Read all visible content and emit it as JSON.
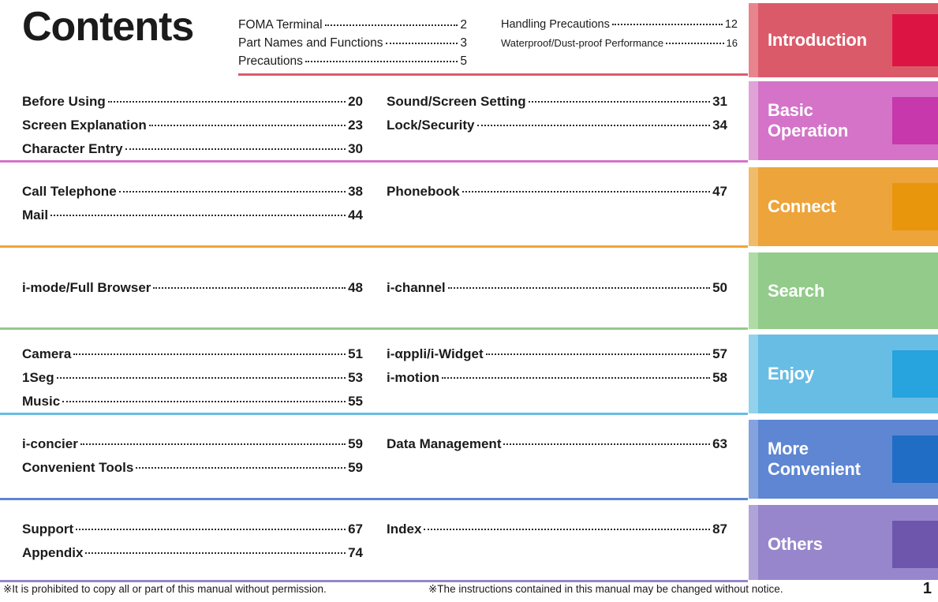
{
  "header": {
    "title": "Contents",
    "col1": [
      {
        "label": "FOMA Terminal",
        "page": "2"
      },
      {
        "label": "Part Names and Functions",
        "page": "3"
      },
      {
        "label": "Precautions",
        "page": "5"
      }
    ],
    "col2": [
      {
        "label": "Handling Precautions",
        "page": "12"
      },
      {
        "label": "Waterproof/Dust-proof Performance",
        "page": "16"
      }
    ]
  },
  "sections": [
    {
      "tab": "Introduction",
      "tab_color": "#db5a69",
      "tab_stripe": "#e8848e",
      "tab_accent": "#dc1444",
      "divider_color": "#db5a69",
      "left": [],
      "right": []
    },
    {
      "tab": "Basic\nOperation",
      "tab_color": "#d473c8",
      "tab_stripe": "#dfa3d8",
      "tab_accent": "#c638ab",
      "divider_color": "#d473c8",
      "left": [
        {
          "label": "Before Using",
          "page": "20"
        },
        {
          "label": "Screen Explanation",
          "page": "23"
        },
        {
          "label": "Character Entry",
          "page": "30"
        }
      ],
      "right": [
        {
          "label": "Sound/Screen Setting",
          "page": "31"
        },
        {
          "label": "Lock/Security",
          "page": "34"
        }
      ]
    },
    {
      "tab": "Connect",
      "tab_color": "#eda43a",
      "tab_stripe": "#f0bb6b",
      "tab_accent": "#e8960c",
      "divider_color": "#eda43a",
      "left": [
        {
          "label": "Call Telephone",
          "page": "38"
        },
        {
          "label": "Mail",
          "page": "44"
        }
      ],
      "right": [
        {
          "label": "Phonebook",
          "page": "47"
        }
      ]
    },
    {
      "tab": "Search",
      "tab_color": "#92cb8a",
      "tab_stripe": "#aedba6",
      "tab_accent": "#65b css",
      "divider_color": "#92cb8a",
      "left": [
        {
          "label": "i-mode/Full Browser",
          "page": "48"
        }
      ],
      "right": [
        {
          "label": "i-channel",
          "page": "50"
        }
      ]
    },
    {
      "tab": "Enjoy",
      "tab_color": "#68bde4",
      "tab_stripe": "#92d2ea",
      "tab_accent": "#27a3dd",
      "divider_color": "#68bde4",
      "left": [
        {
          "label": "Camera",
          "page": "51"
        },
        {
          "label": "1Seg",
          "page": "53"
        },
        {
          "label": "Music",
          "page": "55"
        }
      ],
      "right": [
        {
          "label": "i-αppli/i-Widget",
          "page": "57"
        },
        {
          "label": "i-motion",
          "page": "58"
        }
      ]
    },
    {
      "tab": "More\nConvenient",
      "tab_color": "#5e86d2",
      "tab_stripe": "#84a3de",
      "tab_accent": "#1f6dc4",
      "divider_color": "#5e86d2",
      "left": [
        {
          "label": "i-concier",
          "page": "59"
        },
        {
          "label": "Convenient Tools",
          "page": "59"
        }
      ],
      "right": [
        {
          "label": "Data Management",
          "page": "63"
        }
      ]
    },
    {
      "tab": "Others",
      "tab_color": "#9786cb",
      "tab_stripe": "#b0a3d8",
      "tab_accent": "#6e56ad",
      "divider_color": "#9786cb",
      "left": [
        {
          "label": "Support",
          "page": "67"
        },
        {
          "label": "Appendix",
          "page": "74"
        }
      ],
      "right": [
        {
          "label": "Index",
          "page": "87"
        }
      ]
    }
  ],
  "footer": {
    "note1": "※It is prohibited to copy all or part of this manual without permission.",
    "note2": "※The instructions contained in this manual may be changed without notice.",
    "page_number": "1",
    "rule_color": "#9786cb"
  }
}
